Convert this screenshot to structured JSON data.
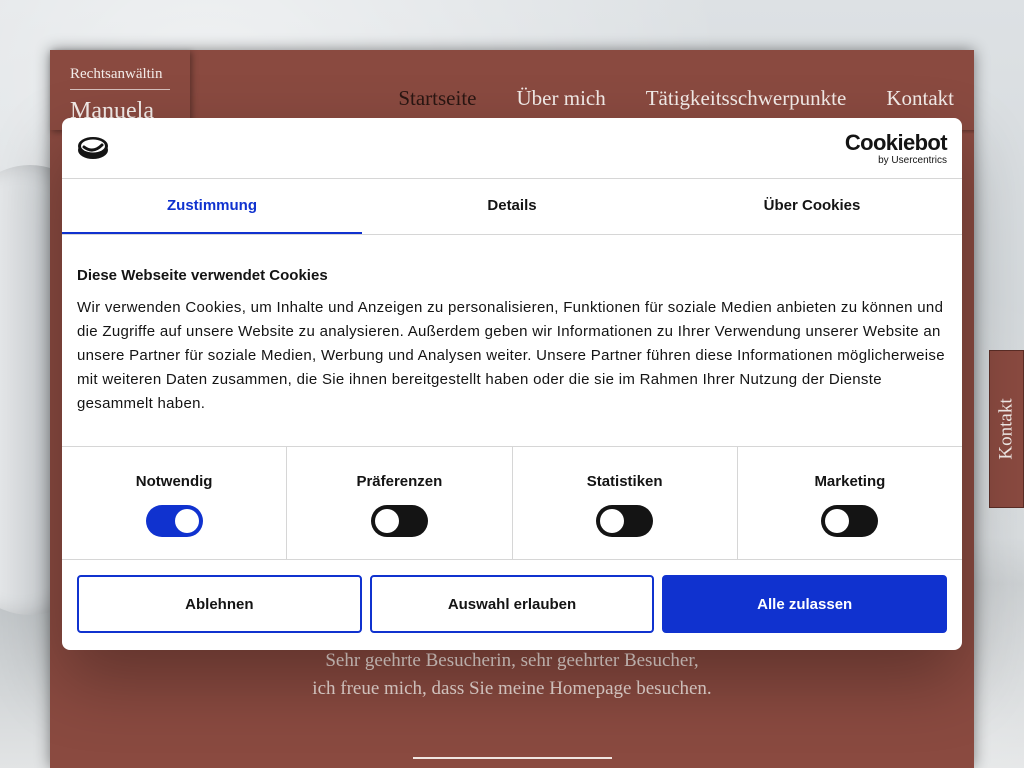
{
  "site": {
    "logo_small": "Rechtsanwältin",
    "logo_name": "Manuela",
    "nav": [
      "Startseite",
      "Über mich",
      "Tätigkeitsschwerpunkte",
      "Kontakt"
    ],
    "welcome_line1": "Sehr geehrte Besucherin, sehr geehrter Besucher,",
    "welcome_line2": "ich freue mich, dass Sie meine Homepage besuchen.",
    "side_tab": "Kontakt"
  },
  "cookie": {
    "brand": "Cookiebot",
    "brand_sub": "by Usercentrics",
    "tabs": [
      "Zustimmung",
      "Details",
      "Über Cookies"
    ],
    "title": "Diese Webseite verwendet Cookies",
    "text": "Wir verwenden Cookies, um Inhalte und Anzeigen zu personalisieren, Funktionen für soziale Medien anbieten zu können und die Zugriffe auf unsere Website zu analysieren. Außerdem geben wir Informationen zu Ihrer Verwendung unserer Website an unsere Partner für soziale Medien, Werbung und Analysen weiter. Unsere Partner führen diese Informationen möglicherweise mit weiteren Daten zusammen, die Sie ihnen bereitgestellt haben oder die sie im Rahmen Ihrer Nutzung der Dienste gesammelt haben.",
    "categories": [
      {
        "label": "Notwendig",
        "enabled": true
      },
      {
        "label": "Präferenzen",
        "enabled": false
      },
      {
        "label": "Statistiken",
        "enabled": false
      },
      {
        "label": "Marketing",
        "enabled": false
      }
    ],
    "buttons": {
      "reject": "Ablehnen",
      "allow_selection": "Auswahl erlauben",
      "allow_all": "Alle zulassen"
    }
  },
  "colors": {
    "brand_red": "#8a4a40",
    "cookie_accent": "#1032cf"
  }
}
